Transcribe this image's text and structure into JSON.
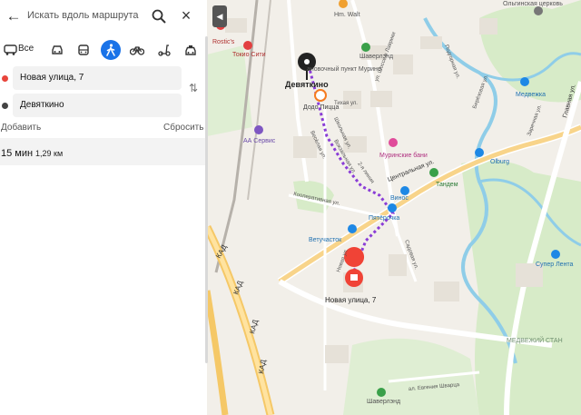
{
  "panel": {
    "search_placeholder": "Искать вдоль маршрута",
    "mode_all_label": "Все",
    "modes": [
      "car-icon",
      "bus-icon",
      "pedestrian-icon",
      "bicycle-icon",
      "scooter-icon",
      "taxi-icon"
    ],
    "active_mode": "pedestrian",
    "from": "Новая улица, 7",
    "to": "Девяткино",
    "add_label": "Добавить",
    "reset_label": "Сбросить",
    "route_time": "15 мин",
    "route_distance": "1,29 км",
    "colors": {
      "active_mode": "#1a73e8",
      "from_dot": "#e8453c",
      "to_dot": "#444444"
    }
  },
  "map": {
    "labels": {
      "hm_walt": "Hm. Walt",
      "olginskaya": "Ольгинская церковь",
      "rostics": "Rostic's",
      "tokio": "Токио Сити",
      "shaverland_top": "Шаверлэнд",
      "transport_hub": "ановочный пункт Мурино",
      "devyatkino": "Девяткино",
      "dodo": "Додо Пицца",
      "medvezhka": "Медвежка",
      "aa_service": "АА Сервис",
      "muriinskie": "Муринские бани",
      "olburg": "Olburg",
      "tandem": "Тандем",
      "vinos": "Винос",
      "pyaterochka": "Пятёрочка",
      "vetuchastok": "Ветучасток",
      "destination": "Новая улица, 7",
      "super_lenta": "Супер Лента",
      "medvezhiy_stan": "МЕДВЕЖИЙ СТАН",
      "shaverland_bottom": "Шаверлэнд",
      "kad1": "КАД",
      "kad2": "КАД",
      "kad3": "КАД",
      "kad4": "КАД",
      "st_tsentralnaya": "Центральная ул.",
      "st_glavnaya": "Главная ул.",
      "st_lavriki": "ул. Шоссе в Лаврики",
      "st_kooperativnaya": "Кооперативная ул.",
      "st_sadovaya": "Садовая ул.",
      "st_evgeniya": "ал. Евгения Шварца",
      "st_tihaya": "Тихая ул.",
      "st_veselaya": "Весёлая ул.",
      "st_shkolnaya": "Школьная ул.",
      "st_vokzalnaya": "Вокзальная ул.",
      "st_2line": "2-я линия",
      "st_novaya": "Новая ул.",
      "st_podgornaya": "Подгорная ул.",
      "st_berezovaya": "Берёзовая ул.",
      "st_zarechnaya": "Заречная ул."
    },
    "colors": {
      "route": "#8a3dd6",
      "water": "#a8d8f0",
      "river": "#7ec3e6",
      "green": "#cfe6c0",
      "destination_pin": "#f04336",
      "start_pin": "#222222"
    }
  }
}
